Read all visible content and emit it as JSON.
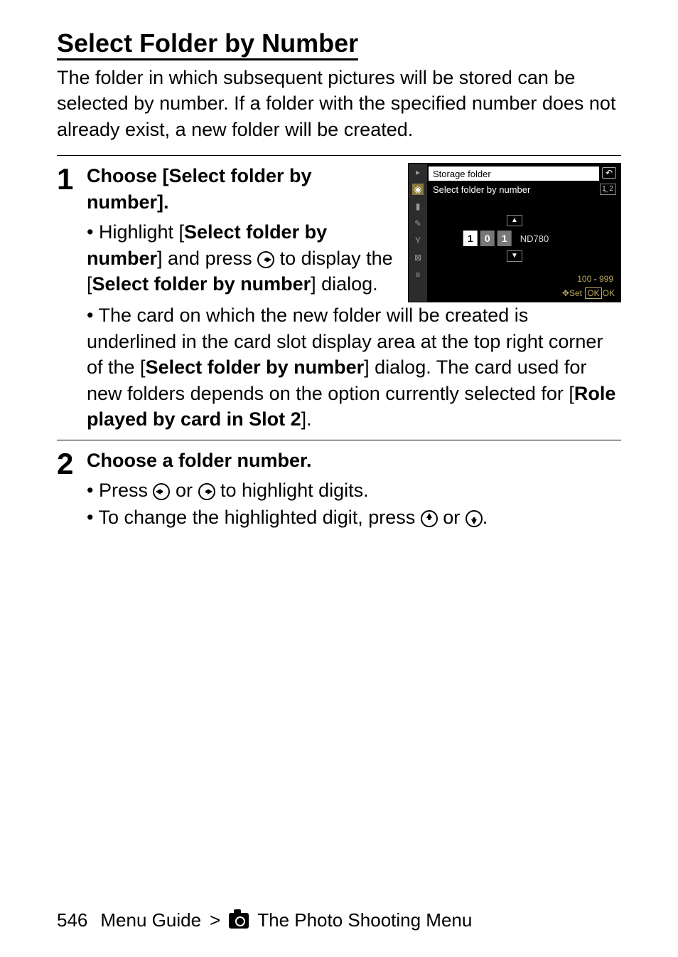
{
  "heading": "Select Folder by Number",
  "intro": "The folder in which subsequent pictures will be stored can be selected by number. If a folder with the specified number does not already exist, a new folder will be created.",
  "steps": [
    {
      "num": "1",
      "title": "Choose [Select folder by number].",
      "bullets": [
        {
          "parts": [
            {
              "t": "• Highlight ["
            },
            {
              "t": "Select folder by number",
              "b": true
            },
            {
              "t": "] and press "
            },
            {
              "icon": "right"
            },
            {
              "t": " to display the ["
            },
            {
              "t": "Select folder by number",
              "b": true
            },
            {
              "t": "] dialog."
            }
          ]
        },
        {
          "parts": [
            {
              "t": "• The card on which the new folder will be created is underlined in the card slot display area at the top right corner of the ["
            },
            {
              "t": "Select folder by number",
              "b": true
            },
            {
              "t": "] dialog. The card used for new folders depends on the option currently selected for ["
            },
            {
              "t": "Role played by card in Slot 2",
              "b": true
            },
            {
              "t": "]."
            }
          ]
        }
      ],
      "screenshot": {
        "title1": "Storage folder",
        "title2": "Select folder by number",
        "back": "↶",
        "cards": "1̲ 2",
        "digits": [
          "1",
          "0",
          "1"
        ],
        "model": "ND780",
        "range_lo": "100",
        "range_hi": "999",
        "set_label": "Set",
        "ok": "OK",
        "ok2": "OK"
      }
    },
    {
      "num": "2",
      "title": "Choose a folder number.",
      "bullets": [
        {
          "parts": [
            {
              "t": "• Press "
            },
            {
              "icon": "left"
            },
            {
              "t": " or "
            },
            {
              "icon": "right"
            },
            {
              "t": " to highlight digits."
            }
          ]
        },
        {
          "parts": [
            {
              "t": "• To change the highlighted digit, press "
            },
            {
              "icon": "up"
            },
            {
              "t": " or "
            },
            {
              "icon": "down"
            },
            {
              "t": "."
            }
          ]
        }
      ]
    }
  ],
  "footer": {
    "page": "546",
    "breadcrumb1": "Menu Guide",
    "sep": ">",
    "breadcrumb2": "The Photo Shooting Menu"
  }
}
